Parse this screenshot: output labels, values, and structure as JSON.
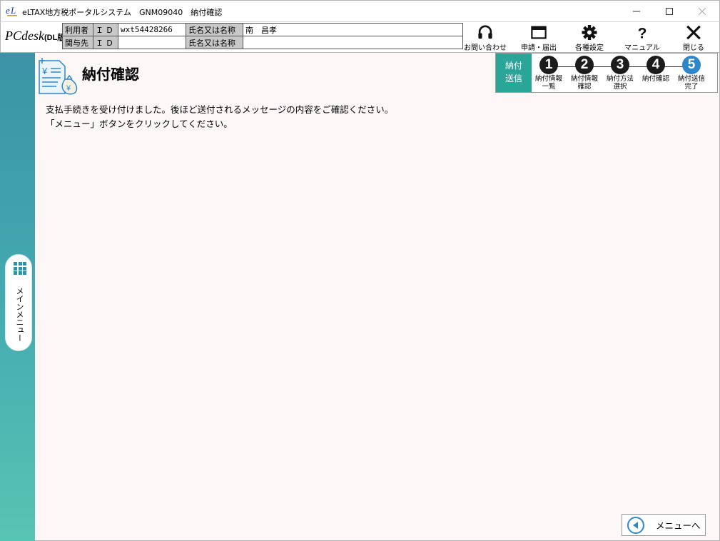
{
  "window": {
    "title": "eLTAX地方税ポータルシステム　GNM09040　納付確認",
    "logo_text": "eL"
  },
  "header": {
    "logo_main": "PCdesk",
    "logo_sub": "(DL版)",
    "user_table": {
      "row1": {
        "label": "利用者",
        "id_label": "ＩＤ",
        "id_value": "wxt54428266",
        "name_label": "氏名又は名称",
        "name_value": "南　昌孝"
      },
      "row2": {
        "label": "関与先",
        "id_label": "ＩＤ",
        "id_value": "",
        "name_label": "氏名又は名称",
        "name_value": ""
      }
    },
    "buttons": {
      "contact": "お問い合わせ",
      "apply": "申請・届出",
      "settings": "各種設定",
      "manual": "マニュアル",
      "close": "閉じる"
    }
  },
  "sidebar": {
    "main_menu_label": "メインメニュー"
  },
  "main": {
    "page_title": "納付確認",
    "message_line1": "支払手続きを受け付けました。後ほど送付されるメッセージの内容をご確認ください。",
    "message_line2": "「メニュー」ボタンをクリックしてください。",
    "steps_label": "納付\n送信",
    "steps": [
      {
        "num": "1",
        "label": "納付情報\n一覧",
        "active": false
      },
      {
        "num": "2",
        "label": "納付情報\n確認",
        "active": false
      },
      {
        "num": "3",
        "label": "納付方法\n選択",
        "active": false
      },
      {
        "num": "4",
        "label": "納付確認",
        "active": false
      },
      {
        "num": "5",
        "label": "納付送信\n完了",
        "active": true
      }
    ],
    "menu_back_button": "メニューへ"
  },
  "colors": {
    "rail_top": "#3a93a6",
    "rail_bottom": "#58c4b3",
    "steps_label_bg": "#2aa597",
    "active_step": "#2f86c9",
    "content_bg": "#fdf8f7"
  }
}
